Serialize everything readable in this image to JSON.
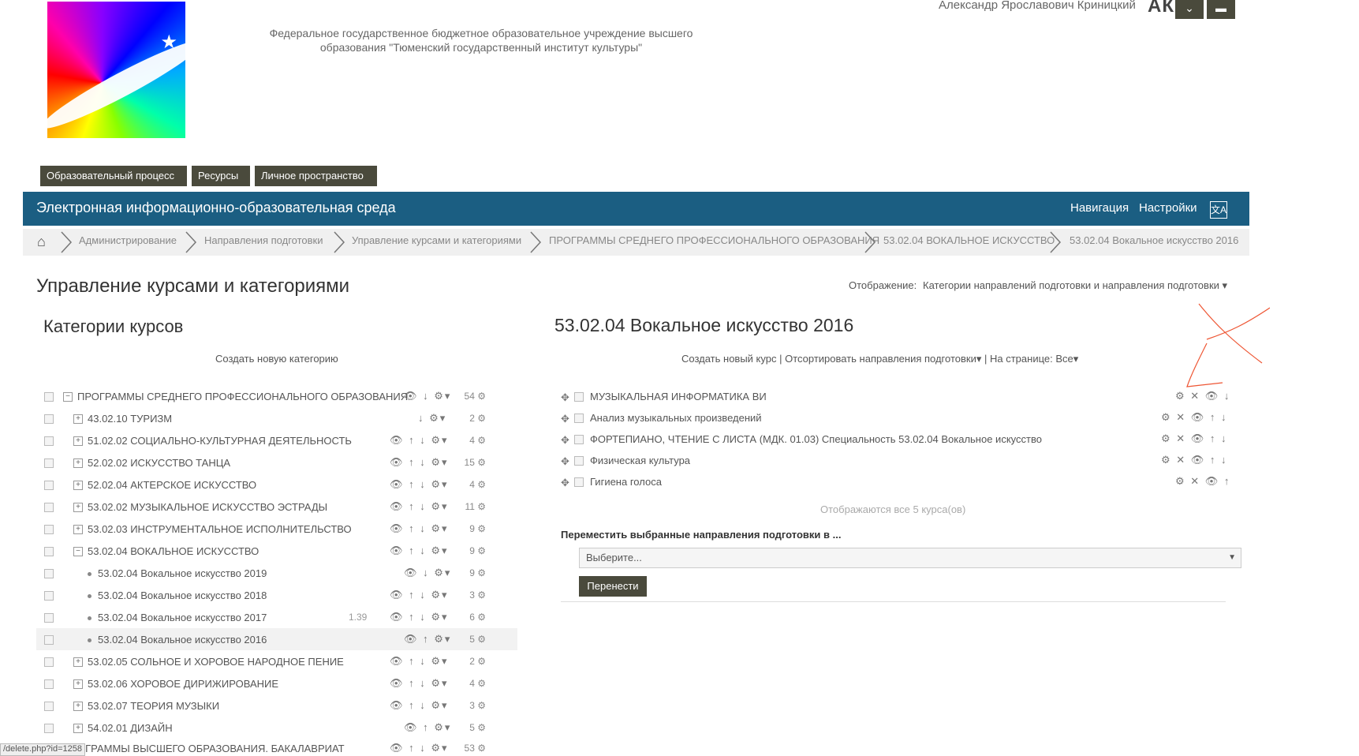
{
  "header": {
    "institution_line1": "Федеральное государственное бюджетное образовательное учреждение  высшего",
    "institution_line2": "образования \"Тюменский государственный институт культуры\"",
    "user_name": "Александр Ярославович Криницкий",
    "avatar": "АК"
  },
  "menu": {
    "items": [
      {
        "label": "Образовательный процесс"
      },
      {
        "label": "Ресурсы"
      },
      {
        "label": "Личное пространство"
      }
    ]
  },
  "navbar": {
    "title": "Электронная информационно-образовательная среда",
    "nav_link": "Навигация",
    "settings_link": "Настройки",
    "lang_icon": "文A"
  },
  "breadcrumb": [
    "Администрирование",
    "Направления подготовки",
    "Управление курсами и категориями",
    "ПРОГРАММЫ СРЕДНЕГО ПРОФЕССИОНАЛЬНОГО ОБРАЗОВАНИЯ",
    "53.02.04 ВОКАЛЬНОЕ ИСКУССТВО",
    "53.02.04 Вокальное искусство 2016"
  ],
  "page": {
    "title": "Управление курсами и категориями",
    "display_label": "Отображение:",
    "display_value": "Категории направлений подготовки и направления подготовки"
  },
  "categories": {
    "heading": "Категории курсов",
    "create_new": "Создать новую категорию",
    "rows": [
      {
        "name": "ПРОГРАММЫ СРЕДНЕГО ПРОФЕССИОНАЛЬНОГО ОБРАЗОВАНИЯ",
        "count": "54",
        "icons": "👁 ↓ ⚙▾"
      },
      {
        "name": "43.02.10 ТУРИЗМ",
        "count": "2",
        "icons": "↓ ⚙▾"
      },
      {
        "name": "51.02.02 СОЦИАЛЬНО-КУЛЬТУРНАЯ ДЕЯТЕЛЬНОСТЬ",
        "count": "4",
        "icons": "👁 ↑ ↓ ⚙▾"
      },
      {
        "name": "52.02.02 ИСКУССТВО ТАНЦА",
        "count": "15",
        "icons": "👁 ↑ ↓ ⚙▾"
      },
      {
        "name": "52.02.04 АКТЕРСКОЕ ИСКУССТВО",
        "count": "4",
        "icons": "👁 ↑ ↓ ⚙▾"
      },
      {
        "name": "53.02.02 МУЗЫКАЛЬНОЕ ИСКУССТВО ЭСТРАДЫ",
        "count": "11",
        "icons": "👁 ↑ ↓ ⚙▾"
      },
      {
        "name": "53.02.03 ИНСТРУМЕНТАЛЬНОЕ ИСПОЛНИТЕЛЬСТВО",
        "count": "9",
        "icons": "👁 ↑ ↓ ⚙▾"
      },
      {
        "name": "53.02.04 ВОКАЛЬНОЕ ИСКУССТВО",
        "count": "9",
        "icons": "👁 ↑ ↓ ⚙▾"
      },
      {
        "name": "53.02.04 Вокальное искусство 2019",
        "count": "9",
        "icons": "👁 ↓ ⚙▾"
      },
      {
        "name": "53.02.04 Вокальное искусство 2018",
        "count": "3",
        "icons": "👁 ↑ ↓ ⚙▾"
      },
      {
        "name": "53.02.04 Вокальное искусство 2017",
        "count": "6",
        "icons": "👁 ↑ ↓ ⚙▾",
        "extra": "1.39"
      },
      {
        "name": "53.02.04 Вокальное искусство 2016",
        "count": "5",
        "icons": "👁 ↑ ⚙▾"
      },
      {
        "name": "53.02.05 СОЛЬНОЕ И ХОРОВОЕ НАРОДНОЕ ПЕНИЕ",
        "count": "2",
        "icons": "👁 ↑ ↓ ⚙▾"
      },
      {
        "name": "53.02.06 ХОРОВОЕ ДИРИЖИРОВАНИЕ",
        "count": "4",
        "icons": "👁 ↑ ↓ ⚙▾"
      },
      {
        "name": "53.02.07 ТЕОРИЯ МУЗЫКИ",
        "count": "3",
        "icons": "👁 ↑ ↓ ⚙▾"
      },
      {
        "name": "54.02.01 ДИЗАЙН",
        "count": "5",
        "icons": "👁 ↑ ⚙▾"
      },
      {
        "name": "ОГРАММЫ ВЫСШЕГО ОБРАЗОВАНИЯ. БАКАЛАВРИАТ",
        "count": "53",
        "icons": "👁 ↑ ↓ ⚙▾"
      }
    ],
    "count_icon": "⚙"
  },
  "courses": {
    "heading": "53.02.04 Вокальное искусство 2016",
    "create_new": "Создать новый курс",
    "sort": "Отсортировать направления подготовки",
    "per_page": "На странице: Все",
    "rows": [
      {
        "name": "МУЗЫКАЛЬНАЯ ИНФОРМАТИКА ВИ",
        "icons": "⚙ ✕ 👁 ↓"
      },
      {
        "name": "Анализ музыкальных произведений",
        "icons": "⚙ ✕ 👁 ↑ ↓"
      },
      {
        "name": "ФОРТЕПИАНО, ЧТЕНИЕ С ЛИСТА (МДК. 01.03) Специальность 53.02.04 Вокальное искусство",
        "icons": "⚙ ✕ 👁 ↑ ↓"
      },
      {
        "name": "Физическая культура",
        "icons": "⚙ ✕ 👁 ↑ ↓"
      },
      {
        "name": "Гигиена голоса",
        "icons": "⚙ ✕ 👁 ↑"
      }
    ],
    "shown_text": "Отображаются все 5 курса(ов)",
    "move_label": "Переместить выбранные направления подготовки в ...",
    "select_placeholder": "Выберите...",
    "move_button": "Перенести"
  },
  "status_url": "/delete.php?id=1258"
}
